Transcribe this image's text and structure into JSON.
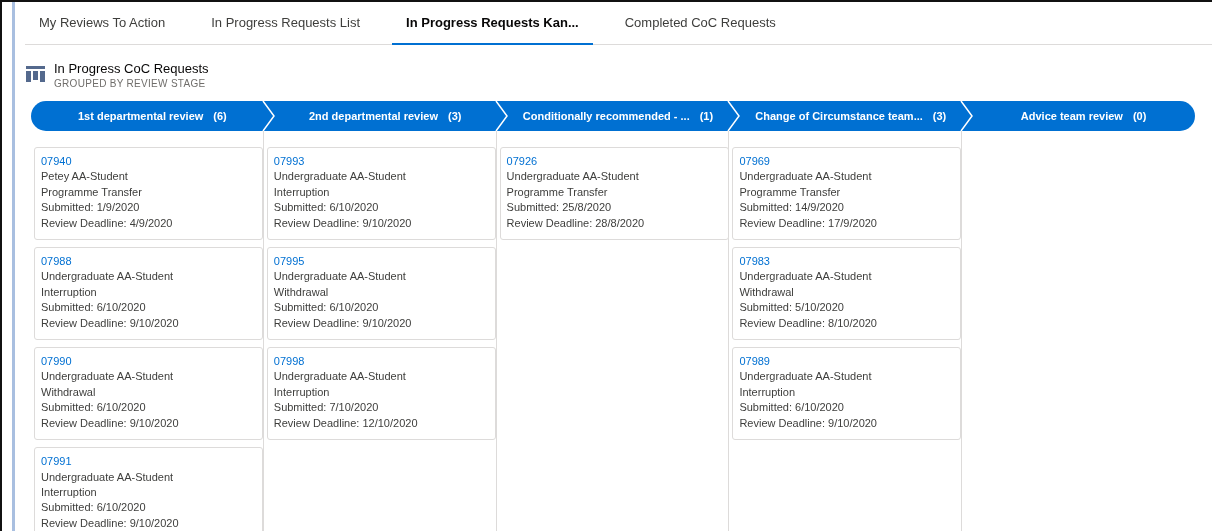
{
  "tabs": [
    {
      "label": "My Reviews To Action",
      "selected": false
    },
    {
      "label": "In Progress Requests List",
      "selected": false
    },
    {
      "label": "In Progress Requests Kan...",
      "selected": true
    },
    {
      "label": "Completed CoC Requests",
      "selected": false
    }
  ],
  "header": {
    "title": "In Progress CoC Requests",
    "subtitle": "GROUPED BY REVIEW STAGE"
  },
  "columns": [
    {
      "name": "1st departmental review",
      "count": "(6)",
      "cards": [
        {
          "id": "07940",
          "student": "Petey AA-Student",
          "type": "Programme Transfer",
          "submitted": "Submitted: 1/9/2020",
          "deadline": "Review Deadline: 4/9/2020"
        },
        {
          "id": "07988",
          "student": "Undergraduate AA-Student",
          "type": "Interruption",
          "submitted": "Submitted: 6/10/2020",
          "deadline": "Review Deadline: 9/10/2020"
        },
        {
          "id": "07990",
          "student": "Undergraduate AA-Student",
          "type": "Withdrawal",
          "submitted": "Submitted: 6/10/2020",
          "deadline": "Review Deadline: 9/10/2020"
        },
        {
          "id": "07991",
          "student": "Undergraduate AA-Student",
          "type": "Interruption",
          "submitted": "Submitted: 6/10/2020",
          "deadline": "Review Deadline: 9/10/2020"
        }
      ]
    },
    {
      "name": "2nd departmental review",
      "count": "(3)",
      "cards": [
        {
          "id": "07993",
          "student": "Undergraduate AA-Student",
          "type": "Interruption",
          "submitted": "Submitted: 6/10/2020",
          "deadline": "Review Deadline: 9/10/2020"
        },
        {
          "id": "07995",
          "student": "Undergraduate AA-Student",
          "type": "Withdrawal",
          "submitted": "Submitted: 6/10/2020",
          "deadline": "Review Deadline: 9/10/2020"
        },
        {
          "id": "07998",
          "student": "Undergraduate AA-Student",
          "type": "Interruption",
          "submitted": "Submitted: 7/10/2020",
          "deadline": "Review Deadline: 12/10/2020"
        }
      ]
    },
    {
      "name": "Conditionally recommended - ...",
      "count": "(1)",
      "cards": [
        {
          "id": "07926",
          "student": "Undergraduate AA-Student",
          "type": "Programme Transfer",
          "submitted": "Submitted: 25/8/2020",
          "deadline": "Review Deadline: 28/8/2020"
        }
      ]
    },
    {
      "name": "Change of Circumstance team...",
      "count": "(3)",
      "cards": [
        {
          "id": "07969",
          "student": "Undergraduate AA-Student",
          "type": "Programme Transfer",
          "submitted": "Submitted: 14/9/2020",
          "deadline": "Review Deadline: 17/9/2020"
        },
        {
          "id": "07983",
          "student": "Undergraduate AA-Student",
          "type": "Withdrawal",
          "submitted": "Submitted: 5/10/2020",
          "deadline": "Review Deadline: 8/10/2020"
        },
        {
          "id": "07989",
          "student": "Undergraduate AA-Student",
          "type": "Interruption",
          "submitted": "Submitted: 6/10/2020",
          "deadline": "Review Deadline: 9/10/2020"
        }
      ]
    },
    {
      "name": "Advice team review",
      "count": "(0)"
    }
  ]
}
